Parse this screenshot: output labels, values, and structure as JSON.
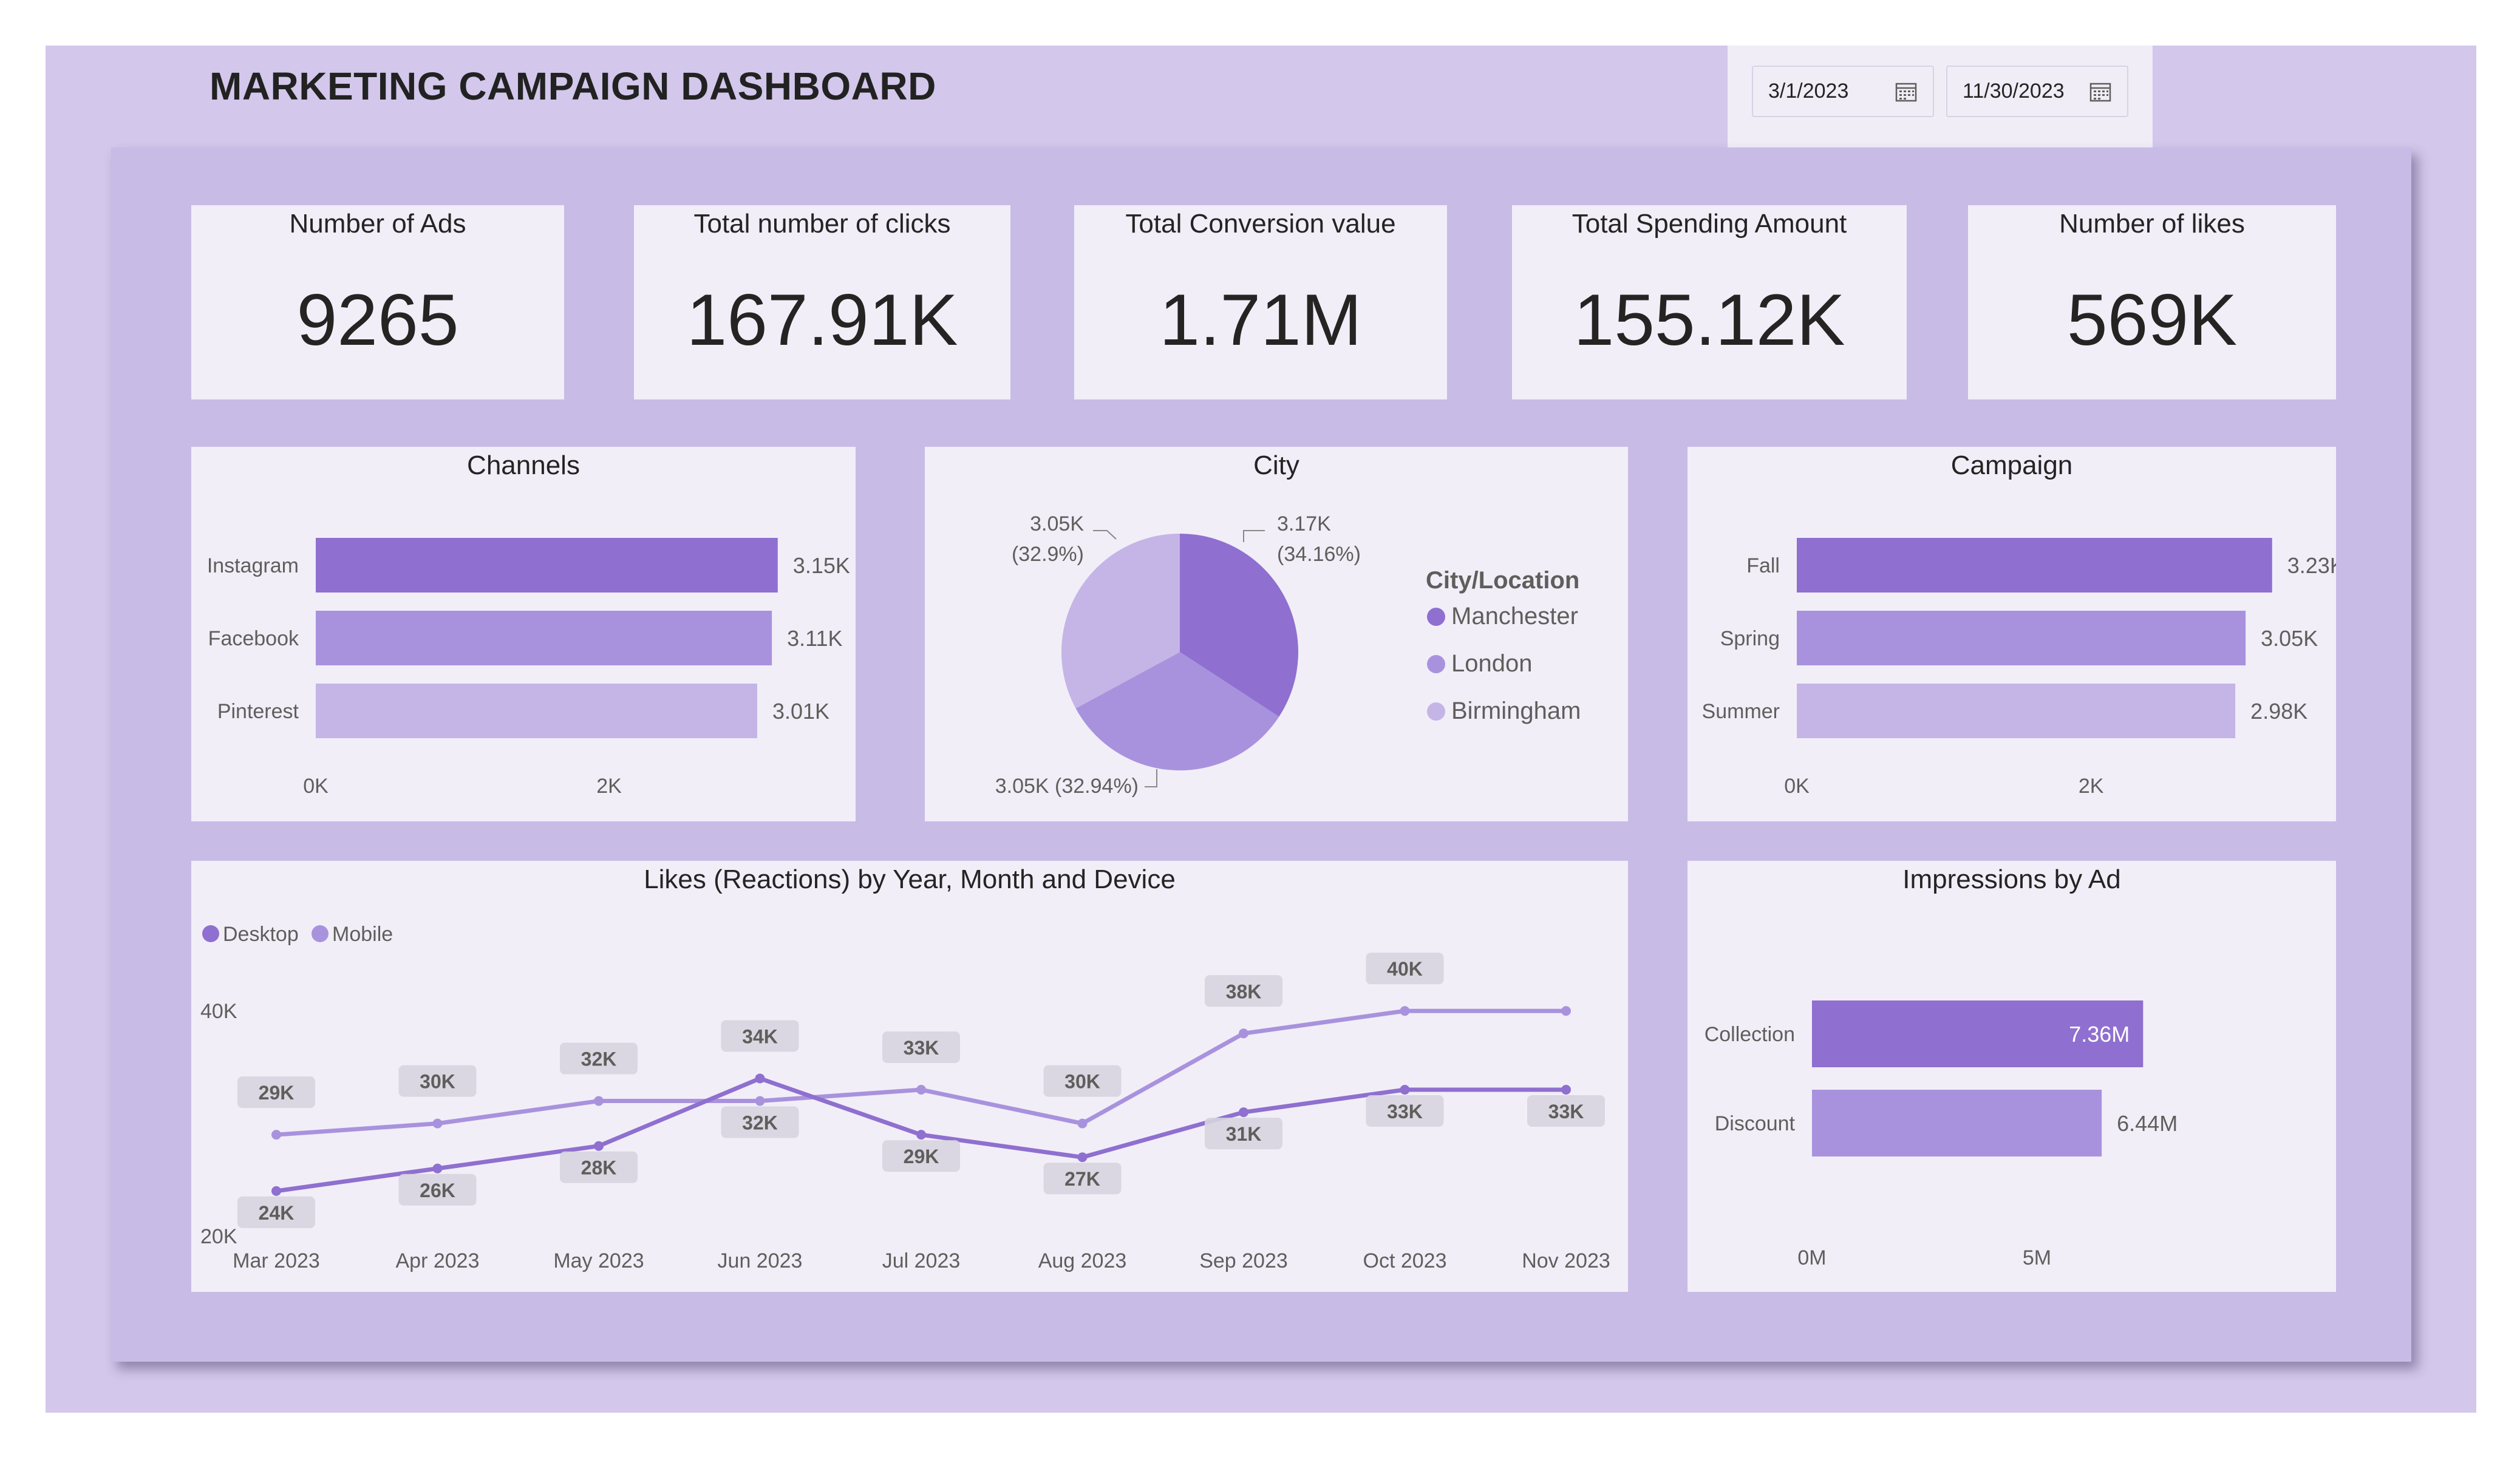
{
  "header": {
    "title": "MARKETING CAMPAIGN DASHBOARD"
  },
  "date_filter": {
    "start": "3/1/2023",
    "end": "11/30/2023"
  },
  "kpis": [
    {
      "label": "Number of Ads",
      "value": "9265"
    },
    {
      "label": "Total number of clicks",
      "value": "167.91K"
    },
    {
      "label": "Total Conversion value",
      "value": "1.71M"
    },
    {
      "label": "Total Spending Amount",
      "value": "155.12K"
    },
    {
      "label": "Number of likes",
      "value": "569K"
    }
  ],
  "colors": {
    "dark": "#8f6fcf",
    "mid": "#a992dd",
    "light": "#c5b5e6",
    "canvas": "#c8bbe6",
    "card": "#f1eef8"
  },
  "chart_data": [
    {
      "type": "bar",
      "title": "Channels",
      "orientation": "horizontal",
      "categories": [
        "Instagram",
        "Facebook",
        "Pinterest"
      ],
      "values": [
        3150,
        3110,
        3010
      ],
      "data_labels": [
        "3.15K",
        "3.11K",
        "3.01K"
      ],
      "xlim": [
        0,
        3540
      ],
      "ticks": [
        {
          "value": 0,
          "label": "0K"
        },
        {
          "value": 2000,
          "label": "2K"
        }
      ]
    },
    {
      "type": "pie",
      "title": "City",
      "legend_title": "City/Location",
      "labels": [
        "Manchester",
        "London",
        "Birmingham"
      ],
      "values": [
        3170,
        3050,
        3050
      ],
      "data_labels": [
        "3.17K",
        "(34.16%)",
        "3.05K (32.94%)",
        "3.05K",
        "(32.9%)"
      ],
      "legend_position": "right"
    },
    {
      "type": "bar",
      "title": "Campaign",
      "orientation": "horizontal",
      "categories": [
        "Fall",
        "Spring",
        "Summer"
      ],
      "values": [
        3230,
        3050,
        2980
      ],
      "data_labels": [
        "3.23K",
        "3.05K",
        "2.98K"
      ],
      "xlim": [
        0,
        3590
      ],
      "ticks": [
        {
          "value": 0,
          "label": "0K"
        },
        {
          "value": 2000,
          "label": "2K"
        }
      ]
    },
    {
      "type": "line",
      "title": "Likes (Reactions) by Year, Month and Device",
      "categories": [
        "Mar 2023",
        "Apr 2023",
        "May 2023",
        "Jun 2023",
        "Jul 2023",
        "Aug 2023",
        "Sep 2023",
        "Oct 2023",
        "Nov 2023"
      ],
      "series": [
        {
          "name": "Desktop",
          "values": [
            24,
            26,
            28,
            34,
            29,
            27,
            31,
            33,
            33
          ],
          "labels": [
            "24K",
            "26K",
            "28K",
            "34K",
            "29K",
            "27K",
            "31K",
            "33K",
            "33K"
          ]
        },
        {
          "name": "Mobile",
          "values": [
            29,
            30,
            32,
            32,
            33,
            30,
            38,
            40,
            40
          ],
          "labels": [
            "29K",
            "30K",
            "32K",
            "32K",
            "33K",
            "30K",
            "38K",
            "40K",
            ""
          ]
        }
      ],
      "ylim": [
        20,
        46
      ],
      "yticks": [
        {
          "value": 40,
          "label": "40K"
        },
        {
          "value": 20,
          "label": "20K"
        }
      ],
      "legend_position": "top-left"
    },
    {
      "type": "bar",
      "title": "Impressions by Ad",
      "orientation": "horizontal",
      "categories": [
        "Collection",
        "Discount"
      ],
      "values": [
        7.36,
        6.44
      ],
      "data_labels": [
        "7.36M",
        "6.44M"
      ],
      "xlim": [
        0,
        11.0
      ],
      "ticks": [
        {
          "value": 0,
          "label": "0M"
        },
        {
          "value": 5,
          "label": "5M"
        }
      ]
    }
  ]
}
